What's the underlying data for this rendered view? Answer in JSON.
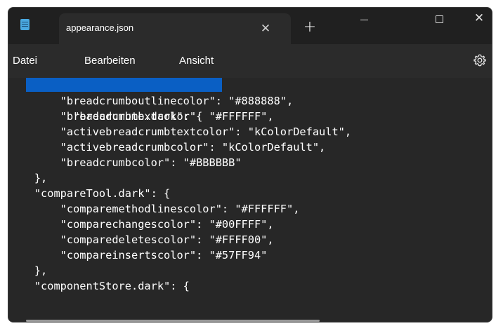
{
  "window": {
    "tab_title": "appearance.json",
    "tab_close": "✕",
    "new_tab": "+",
    "close": "✕"
  },
  "menu": {
    "file": "Datei",
    "edit": "Bearbeiten",
    "view": "Ansicht",
    "settings_icon": "gear-icon"
  },
  "editor": {
    "lines": [
      "    \"breadcrumb.dark\": {",
      "        \"breadcrumboutlinecolor\": \"#888888\",",
      "        \"breadcrumbtextcolor\": \"#FFFFFF\",",
      "        \"activebreadcrumbtextcolor\": \"kColorDefault\",",
      "        \"activebreadcrumbcolor\": \"kColorDefault\",",
      "        \"breadcrumbcolor\": \"#BBBBBB\"",
      "    },",
      "    \"compareTool.dark\": {",
      "        \"comparemethodlinescolor\": \"#FFFFFF\",",
      "        \"comparechangescolor\": \"#00FFFF\",",
      "        \"comparedeletescolor\": \"#FFFF00\",",
      "        \"compareinsertscolor\": \"#57FF94\"",
      "    },",
      "    \"componentStore.dark\": {"
    ],
    "selected_text": "\"breadcrumb.dark\": {"
  },
  "colors": {
    "selection": "#0a5fc4",
    "editor_bg": "#272727",
    "menubar_bg": "#2b2b2b",
    "titlebar_bg": "#202020"
  }
}
